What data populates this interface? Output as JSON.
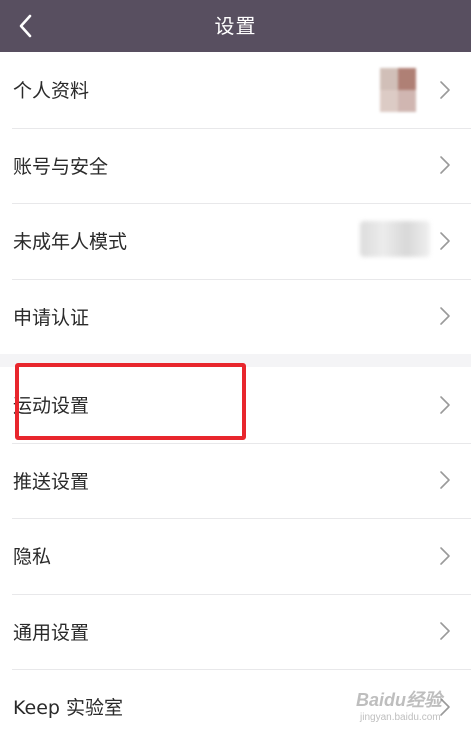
{
  "navbar": {
    "title": "设置",
    "back_icon": "chevron-left-icon",
    "background": "#584f60"
  },
  "group1": {
    "items": [
      {
        "label": "个人资料"
      },
      {
        "label": "账号与安全"
      },
      {
        "label": "未成年人模式"
      },
      {
        "label": "申请认证"
      }
    ]
  },
  "group2": {
    "items": [
      {
        "label": "运动设置"
      },
      {
        "label": "推送设置"
      },
      {
        "label": "隐私"
      },
      {
        "label": "通用设置"
      },
      {
        "label": "Keep 实验室"
      }
    ]
  },
  "highlight": {
    "color": "#e8262d",
    "target": "运动设置"
  },
  "watermark": {
    "line1": "Baidu经验",
    "line2": "jingyan.baidu.com"
  }
}
